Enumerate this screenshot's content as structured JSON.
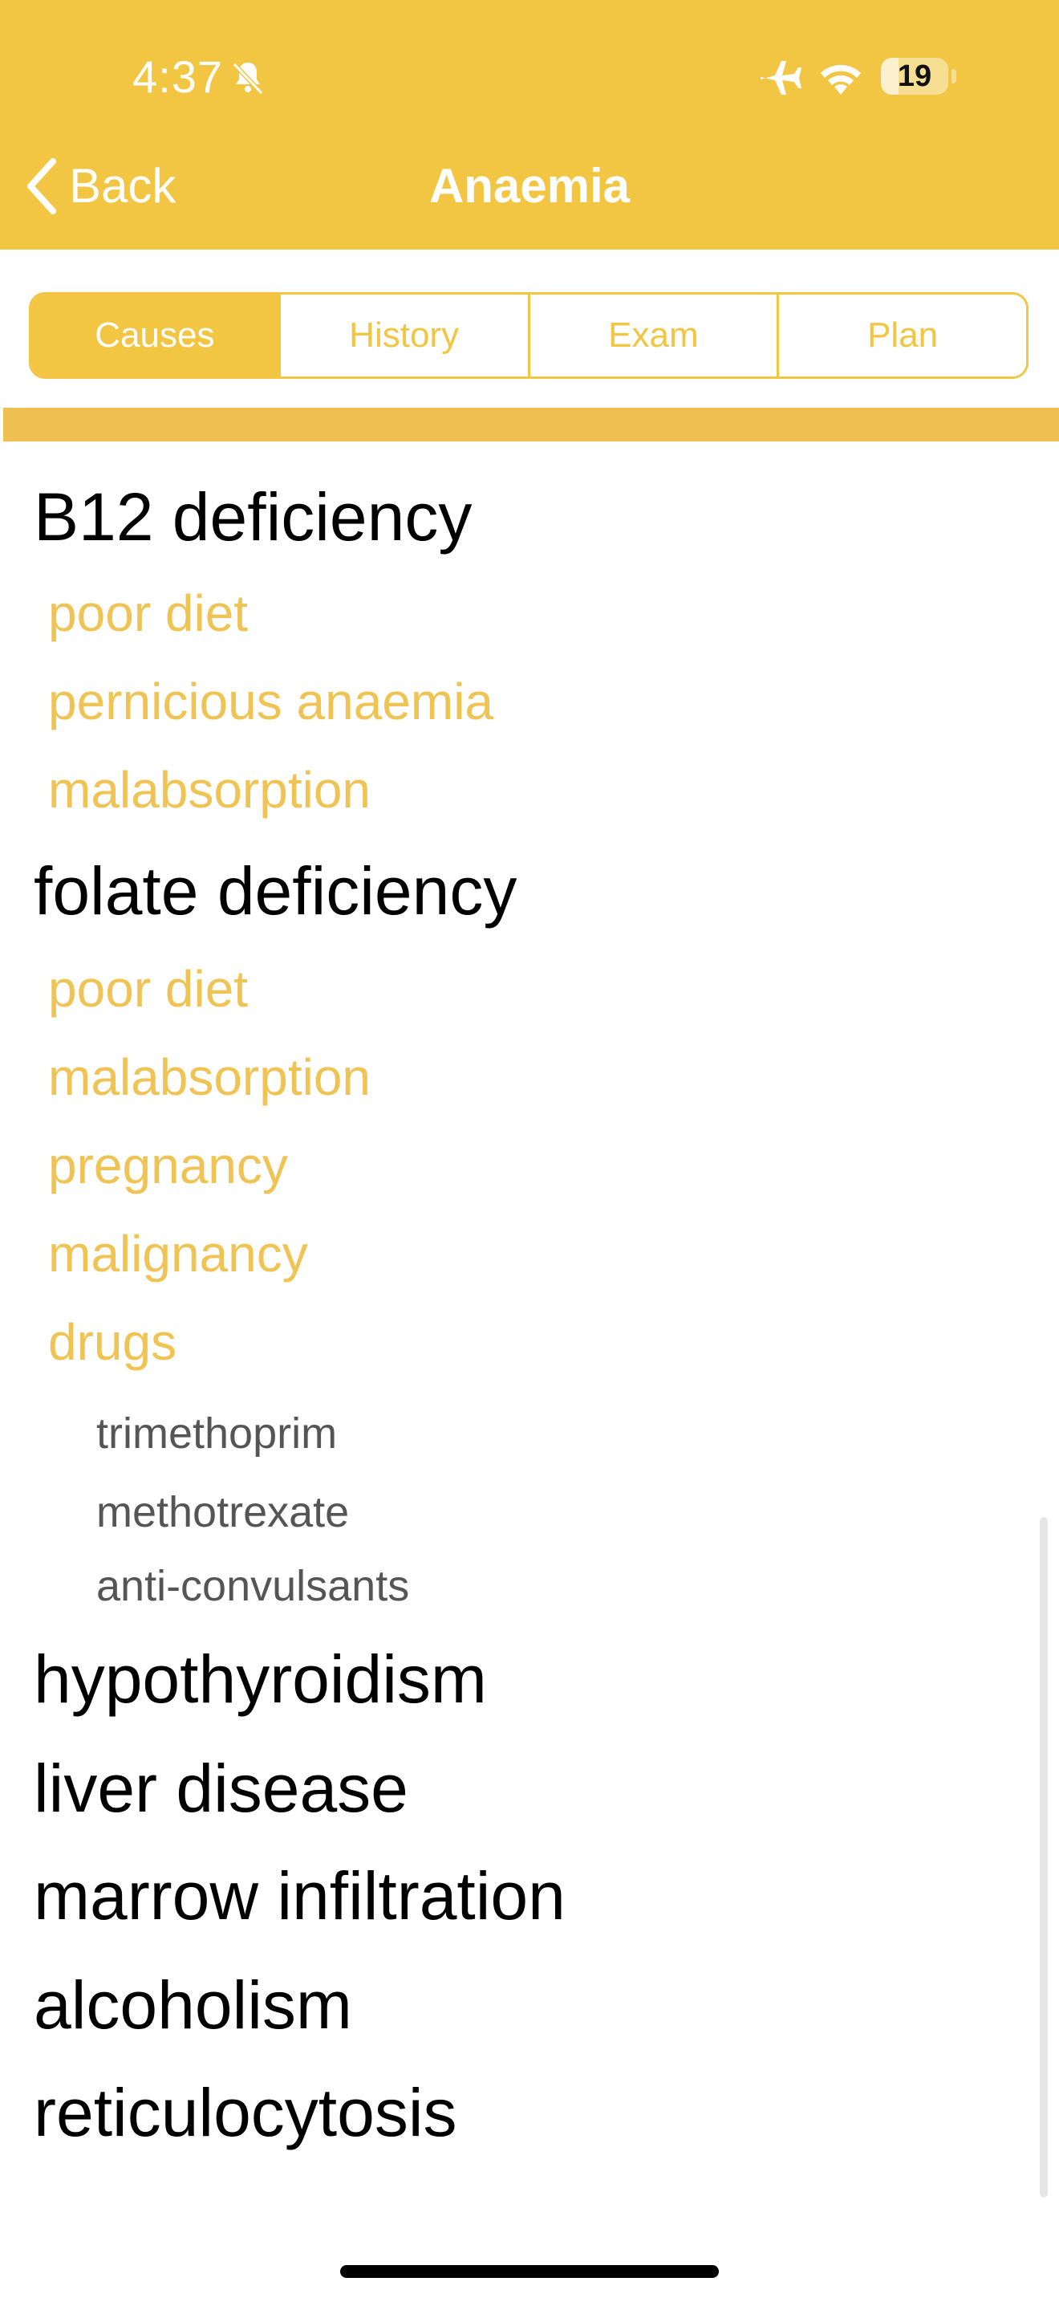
{
  "status_bar": {
    "time": "4:37",
    "battery": "19"
  },
  "nav": {
    "back_label": "Back",
    "title": "Anaemia"
  },
  "tabs": [
    {
      "label": "Causes",
      "active": true
    },
    {
      "label": "History",
      "active": false
    },
    {
      "label": "Exam",
      "active": false
    },
    {
      "label": "Plan",
      "active": false
    }
  ],
  "causes": {
    "b12": {
      "title": "B12 deficiency",
      "items": [
        "poor diet",
        "pernicious anaemia",
        "malabsorption"
      ]
    },
    "folate": {
      "title": "folate deficiency",
      "items": [
        "poor diet",
        "malabsorption",
        "pregnancy",
        "malignancy",
        "drugs"
      ],
      "drugs": [
        "trimethoprim",
        "methotrexate",
        "anti-convulsants"
      ]
    },
    "others": [
      "hypothyroidism",
      "liver disease",
      "marrow infiltration",
      "alcoholism",
      "reticulocytosis"
    ]
  },
  "colors": {
    "accent": "#f2c542",
    "divider": "#efbf52",
    "subitem": "#f0c355",
    "drug": "#555555"
  },
  "icons": {
    "back": "chevron-left-icon",
    "bell": "bell-slash-icon",
    "plane": "airplane-icon",
    "wifi": "wifi-icon"
  }
}
